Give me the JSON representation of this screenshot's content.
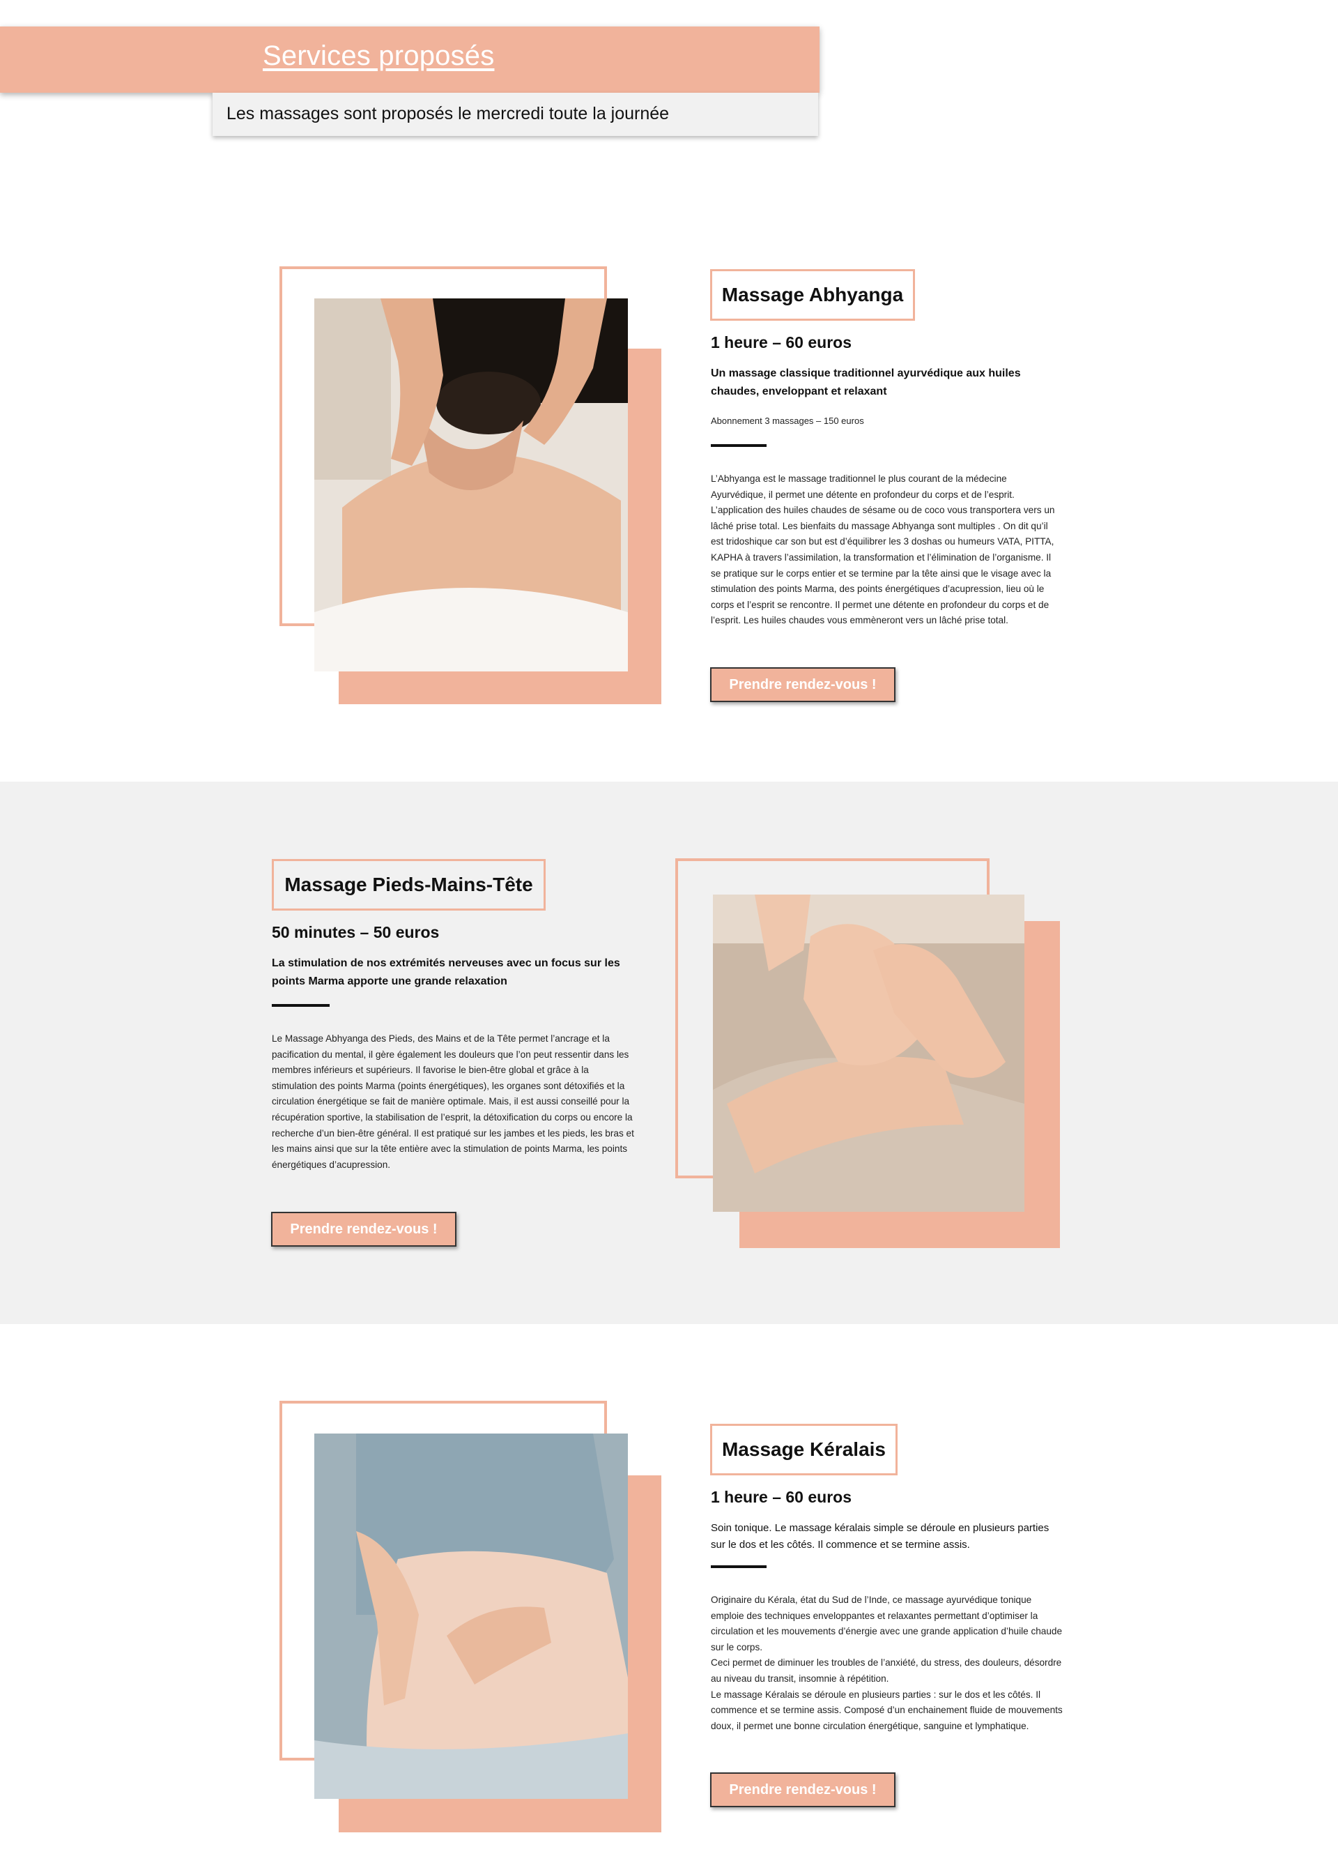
{
  "header": {
    "title_link": "Services proposés",
    "notice": "Les massages sont proposés le mercredi toute la journée"
  },
  "colors": {
    "accent": "#f1b39b",
    "band_background": "#f1f1f1",
    "text": "#111111"
  },
  "services": [
    {
      "title": "Massage Abhyanga",
      "price": "1 heure – 60 euros",
      "subtitle": "Un massage classique traditionnel ayurvédique aux huiles chaudes, enveloppant et relaxant",
      "subscription": "Abonnement 3 massages – 150 euros",
      "description": "L’Abhyanga est le massage traditionnel le plus courant de la médecine Ayurvédique, il permet une détente en profondeur du corps et de l’esprit. L’application des huiles chaudes de sésame ou de coco vous transportera vers un lâché prise total. Les bienfaits du massage Abhyanga sont multiples . On dit qu’il est tridoshique car son but est d’équilibrer les 3 doshas ou humeurs VATA, PITTA, KAPHA à travers l’assimilation, la transformation et l’élimination de l’organisme. Il se pratique sur le corps entier et se termine par la tête ainsi que le visage avec la stimulation des points Marma, des points énergétiques d’acupression, lieu où le corps et l’esprit se rencontre. Il permet une détente en profondeur du corps et de l’esprit. Les huiles chaudes vous emmèneront vers un lâché prise total.",
      "cta": "Prendre rendez-vous !",
      "image": "back-massage-photo"
    },
    {
      "title": "Massage Pieds-Mains-Tête",
      "price": "50 minutes – 50 euros",
      "subtitle": "La stimulation de nos extrémités nerveuses avec un focus sur les points Marma apporte une grande relaxation",
      "description": "Le Massage Abhyanga des Pieds, des Mains et de la Tête permet l’ancrage et la pacification du mental, il gère également les douleurs que l’on peut ressentir dans les membres inférieurs et supérieurs. Il favorise le bien-être global et grâce à la stimulation des points Marma (points énergétiques), les organes sont détoxifiés et la circulation énergétique se fait de manière optimale. Mais, il est aussi conseillé pour la récupération sportive, la stabilisation de l’esprit, la détoxification du corps ou encore la recherche d’un bien-être général. Il est pratiqué sur les jambes et les pieds, les bras et les mains ainsi que sur la tête entière avec la stimulation de points Marma, les points énergétiques d’acupression.",
      "cta": "Prendre rendez-vous !",
      "image": "hands-massage-photo"
    },
    {
      "title": "Massage Kéralais",
      "price": "1 heure – 60 euros",
      "subtitle": "Soin tonique. Le massage kéralais simple se déroule en plusieurs parties sur le dos et les côtés. Il commence et se termine assis.",
      "description_lines": [
        "Originaire du Kérala, état du Sud de l’Inde, ce massage ayurvédique tonique emploie des techniques enveloppantes et relaxantes permettant d’optimiser la circulation et les mouvements d’énergie avec une grande application d’huile chaude sur le corps.",
        "Ceci permet de diminuer les troubles de l’anxiété, du stress, des douleurs, désordre au niveau du transit, insomnie à répétition.",
        "Le massage Kéralais se déroule en plusieurs parties : sur le dos et les côtés. Il commence et se termine assis. Composé d’un enchainement fluide de mouvements doux, il permet une bonne circulation énergétique, sanguine et lymphatique."
      ],
      "cta": "Prendre rendez-vous !",
      "image": "keralais-massage-photo"
    }
  ]
}
